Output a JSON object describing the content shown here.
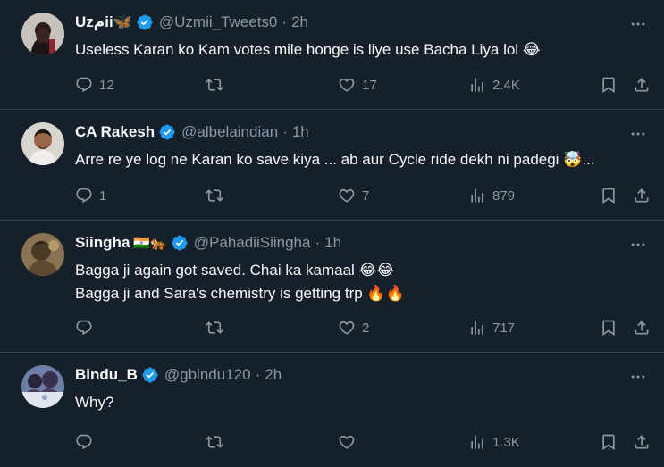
{
  "tweets": [
    {
      "name": "Uzمii🦋",
      "handle": "@Uzmii_Tweets0",
      "separator": "·",
      "time": "2h",
      "lines": [
        "Useless Karan ko Kam votes mile honge is liye use Bacha Liya lol 😂"
      ],
      "replies": "12",
      "retweets": "",
      "likes": "17",
      "views": "2.4K"
    },
    {
      "name": "CA Rakesh",
      "handle": "@albelaindian",
      "separator": "·",
      "time": "1h",
      "lines": [
        "Arre re ye log ne Karan ko save kiya ... ab aur Cycle ride dekh ni padegi 🤯..."
      ],
      "replies": "1",
      "retweets": "",
      "likes": "7",
      "views": "879"
    },
    {
      "name": "Siingha",
      "flags": "🇮🇳🐅",
      "handle": "@PahadiiSiingha",
      "separator": "·",
      "time": "1h",
      "lines": [
        "Bagga ji again got saved. Chai ka kamaal 😂😂",
        "Bagga ji and Sara's chemistry is getting trp 🔥🔥"
      ],
      "replies": "",
      "retweets": "",
      "likes": "2",
      "views": "717"
    },
    {
      "name": "Bindu_B",
      "handle": "@gbindu120",
      "separator": "·",
      "time": "2h",
      "lines": [
        "Why?"
      ],
      "replies": "",
      "retweets": "",
      "likes": "",
      "views": "1.3K"
    }
  ],
  "icons": {
    "verified": "verified-badge-icon",
    "more": "more-options-icon",
    "reply": "reply-icon",
    "retweet": "retweet-icon",
    "like": "like-icon",
    "views": "views-icon",
    "bookmark": "bookmark-icon",
    "share": "share-icon"
  },
  "colors": {
    "background": "#15202b",
    "divider": "#38444d",
    "primary_text": "#f7f9f9",
    "secondary_text": "#8b98a5",
    "verified": "#1d9bf0"
  }
}
